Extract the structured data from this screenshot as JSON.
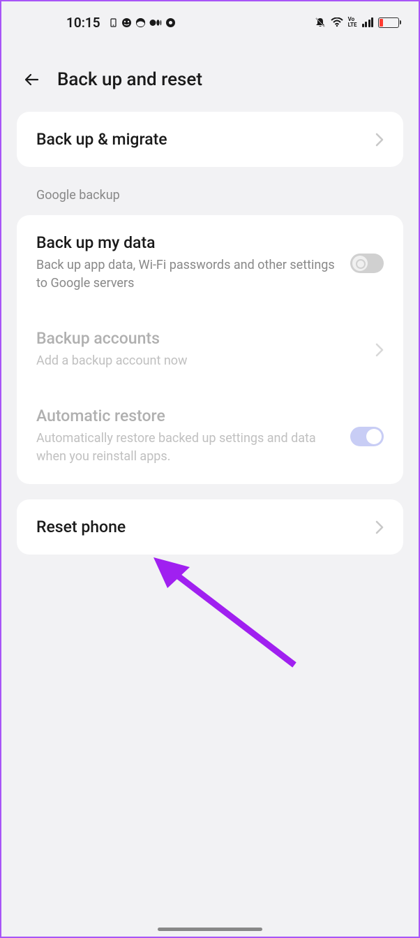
{
  "statusBar": {
    "time": "10:15"
  },
  "header": {
    "title": "Back up and reset"
  },
  "backupMigrate": {
    "title": "Back up & migrate"
  },
  "sectionHeader": "Google backup",
  "googleBackup": {
    "backupData": {
      "title": "Back up my data",
      "subtitle": "Back up app data, Wi-Fi passwords and other settings to Google servers"
    },
    "backupAccounts": {
      "title": "Backup accounts",
      "subtitle": "Add a backup account now"
    },
    "automaticRestore": {
      "title": "Automatic restore",
      "subtitle": "Automatically restore backed up settings and data when you reinstall apps."
    }
  },
  "resetPhone": {
    "title": "Reset phone"
  }
}
